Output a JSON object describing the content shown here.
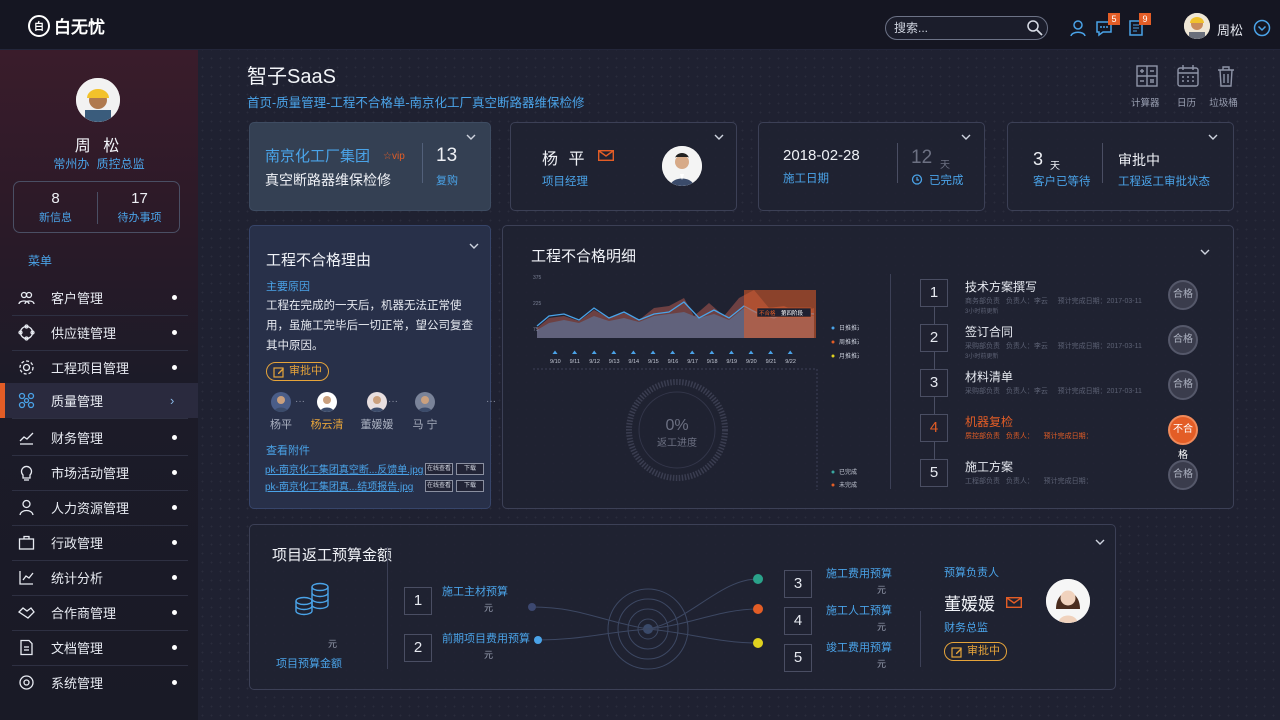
{
  "app": {
    "logo": "白无忧"
  },
  "topbar": {
    "search_placeholder": "搜索...",
    "badge_messages": "5",
    "badge_notes": "9",
    "user_name": "周松"
  },
  "sidebar": {
    "user_name": "周 松",
    "user_org": "常州办",
    "user_dept": "质控总监",
    "stats": [
      {
        "num": "8",
        "label": "新信息"
      },
      {
        "num": "17",
        "label": "待办事项"
      }
    ],
    "menu_title": "菜单",
    "items": [
      {
        "label": "客户管理",
        "icon": "users-icon"
      },
      {
        "label": "供应链管理",
        "icon": "chain-icon"
      },
      {
        "label": "工程项目管理",
        "icon": "gear-icon"
      },
      {
        "label": "质量管理",
        "icon": "quality-icon"
      },
      {
        "label": "财务管理",
        "icon": "finance-icon"
      },
      {
        "label": "市场活动管理",
        "icon": "bulb-icon"
      },
      {
        "label": "人力资源管理",
        "icon": "person-icon"
      },
      {
        "label": "行政管理",
        "icon": "briefcase-icon"
      },
      {
        "label": "统计分析",
        "icon": "chart-icon"
      },
      {
        "label": "合作商管理",
        "icon": "handshake-icon"
      },
      {
        "label": "文档管理",
        "icon": "document-icon"
      },
      {
        "label": "系统管理",
        "icon": "system-icon"
      }
    ]
  },
  "header": {
    "title": "智子SaaS",
    "breadcrumb": "首页-质量管理-工程不合格单-南京化工厂真空断路器维保检修",
    "tools": [
      {
        "label": "计算器",
        "icon": "calculator-icon"
      },
      {
        "label": "日历",
        "icon": "calendar-icon"
      },
      {
        "label": "垃圾桶",
        "icon": "trash-icon"
      }
    ]
  },
  "card_company": {
    "company": "南京化工厂集团",
    "vip": "vip",
    "project": "真空断路器维保检修",
    "count": "13",
    "count_label": "复购"
  },
  "card_manager": {
    "name": "杨 平",
    "role": "项目经理"
  },
  "card_date": {
    "date": "2018-02-28",
    "date_label": "施工日期",
    "days": "12",
    "days_unit": "天",
    "status": "已完成"
  },
  "card_status": {
    "wait_num": "3",
    "wait_unit": "天",
    "wait_label": "客户已等待",
    "status": "审批中",
    "status_label": "工程返工审批状态"
  },
  "reason": {
    "title": "工程不合格理由",
    "sub": "主要原因",
    "text": "工程在完成的一天后，机器无法正常使用，虽施工完毕后一切正常，望公司复查其中原因。",
    "tag": "审批中",
    "people": [
      "杨平",
      "杨云清",
      "董媛媛",
      "马 宁"
    ],
    "attach_title": "查看附件",
    "files": [
      "pk-南京化工集团真空断...反馈单.jpg",
      "pk-南京化工集团真...结项报告.jpg"
    ],
    "btn_view": "在线查看",
    "btn_download": "下载"
  },
  "detail": {
    "title": "工程不合格明细",
    "y_ticks": [
      "375",
      "225",
      "75"
    ],
    "dates": [
      "9/10",
      "9/11",
      "9/12",
      "9/13",
      "9/14",
      "9/15",
      "9/16",
      "9/17",
      "9/18",
      "9/19",
      "9/20",
      "9/21",
      "9/22"
    ],
    "band_labels": [
      "不合格",
      "第四阶段"
    ],
    "legend": [
      "日推推进",
      "周推推进",
      "月推推进"
    ],
    "progress_value": "0%",
    "progress_label": "返工进度",
    "progress_legend": [
      "已完成",
      "未完成"
    ],
    "steps": [
      {
        "num": "1",
        "title": "技术方案撰写",
        "meta1": "商务部负责",
        "meta2": "负责人：李云",
        "meta3": "预计完成日期：2017-03-11",
        "meta4": "3小时前更新",
        "status": "合格"
      },
      {
        "num": "2",
        "title": "签订合同",
        "meta1": "采购部负责",
        "meta2": "负责人：李云",
        "meta3": "预计完成日期：2017-03-11",
        "meta4": "3小时前更新",
        "status": "合格"
      },
      {
        "num": "3",
        "title": "材料清单",
        "meta1": "采购部负责",
        "meta2": "负责人：李云",
        "meta3": "预计完成日期：2017-03-11",
        "meta4": "",
        "status": "合格"
      },
      {
        "num": "4",
        "title": "机器复检",
        "meta1": "质控部负责",
        "meta2": "负责人：",
        "meta3": "预计完成日期：",
        "meta4": "",
        "status": "不合格"
      },
      {
        "num": "5",
        "title": "施工方案",
        "meta1": "工程部负责",
        "meta2": "负责人：",
        "meta3": "预计完成日期：",
        "meta4": "",
        "status": "合格"
      }
    ]
  },
  "budget": {
    "title": "项目返工预算金额",
    "unit": "元",
    "total_label": "项目预算金额",
    "items_left": [
      {
        "num": "1",
        "label": "施工主材预算",
        "unit": "元"
      },
      {
        "num": "2",
        "label": "前期项目费用预算",
        "unit": "元"
      }
    ],
    "items_right": [
      {
        "num": "3",
        "label": "施工费用预算",
        "unit": "元"
      },
      {
        "num": "4",
        "label": "施工人工预算",
        "unit": "元"
      },
      {
        "num": "5",
        "label": "竣工费用预算",
        "unit": "元"
      }
    ],
    "owner_title": "预算负责人",
    "owner_name": "董媛媛",
    "owner_role": "财务总监",
    "owner_status": "审批中"
  },
  "colors": {
    "accent": "#e35d26",
    "link": "#4aa3e8",
    "tag": "#e6a43a",
    "teal": "#3aa7a0"
  }
}
